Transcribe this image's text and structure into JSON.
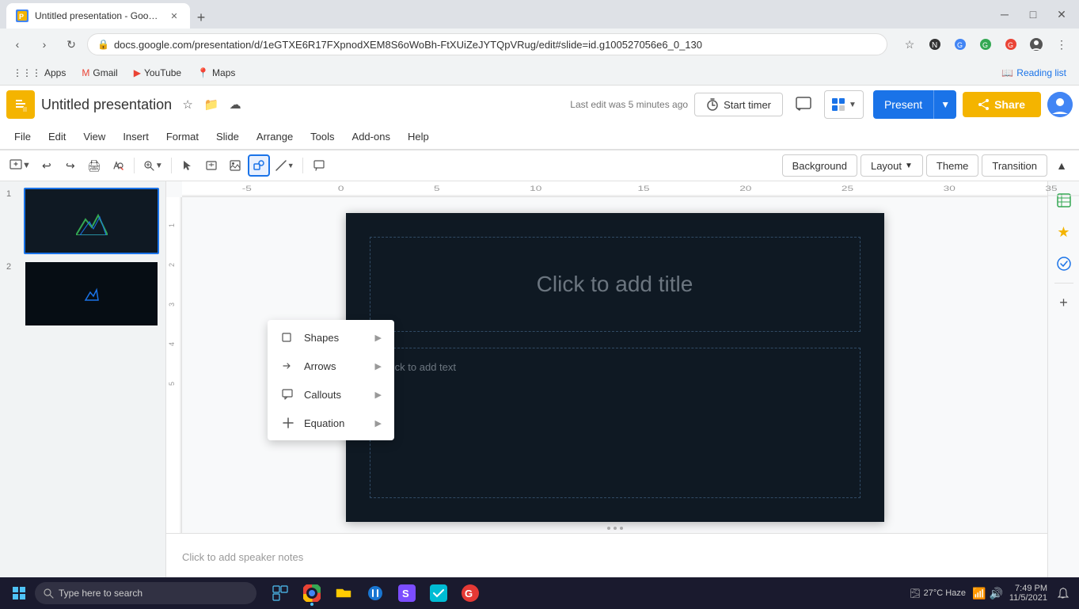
{
  "browser": {
    "tab_title": "Untitled presentation - Google S",
    "url": "docs.google.com/presentation/d/1eGTXE6R17FXpnodXEM8S6oWoBh-FtXUiZeJYTQpVRug/edit#slide=id.g100527056e6_0_130",
    "new_tab_icon": "+",
    "back_icon": "‹",
    "forward_icon": "›",
    "refresh_icon": "↻"
  },
  "bookmarks": {
    "items": [
      "Apps",
      "Gmail",
      "YouTube",
      "Maps"
    ],
    "reading_list": "Reading list"
  },
  "app": {
    "logo_letter": "P",
    "title": "Untitled presentation",
    "last_edit": "Last edit was 5 minutes ago",
    "start_timer": "Start timer",
    "present": "Present",
    "share": "Share"
  },
  "menu": {
    "items": [
      "File",
      "Edit",
      "View",
      "Insert",
      "Format",
      "Slide",
      "Arrange",
      "Tools",
      "Add-ons",
      "Help"
    ]
  },
  "toolbar": {
    "background_label": "Background",
    "theme_label": "Theme",
    "transition_label": "Transition",
    "layout_label": "Layout"
  },
  "slides": [
    {
      "num": "1"
    },
    {
      "num": "2"
    }
  ],
  "slide_canvas": {
    "title_placeholder": "Click to add title",
    "content_placeholder": "Click to add text"
  },
  "speaker_notes": {
    "placeholder": "Click to add speaker notes"
  },
  "dropdown_menu": {
    "items": [
      {
        "label": "Shapes",
        "has_arrow": true,
        "icon": "□"
      },
      {
        "label": "Arrows",
        "has_arrow": true,
        "icon": "→"
      },
      {
        "label": "Callouts",
        "has_arrow": true,
        "icon": "⬜"
      },
      {
        "label": "Equation",
        "has_arrow": true,
        "icon": "+"
      }
    ]
  },
  "taskbar": {
    "search_placeholder": "Type here to search",
    "time": "7:49 PM",
    "date": "11/5/2021",
    "weather": "27°C Haze"
  }
}
